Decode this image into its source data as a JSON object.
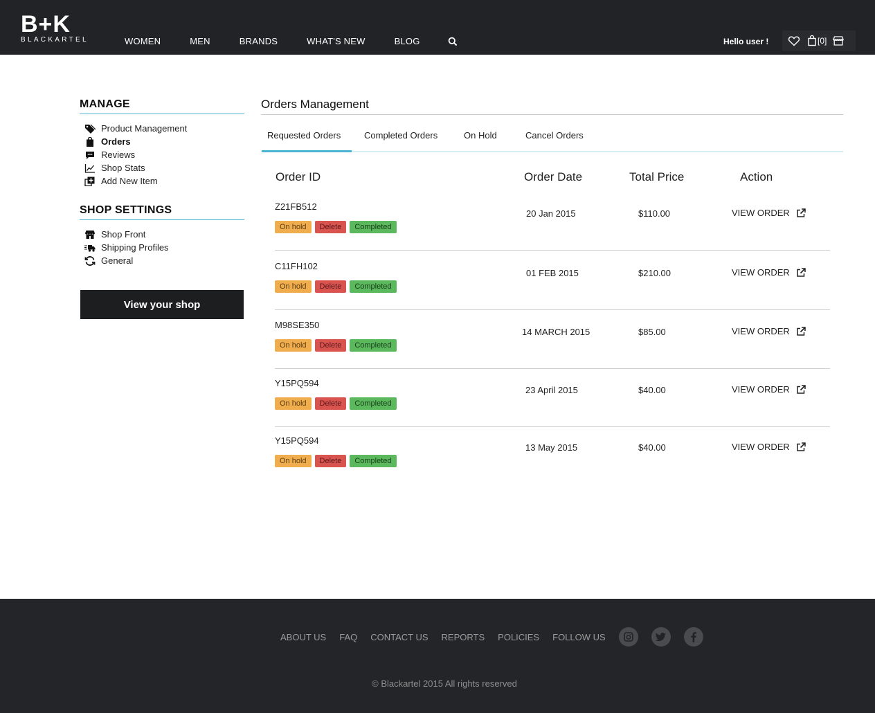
{
  "header": {
    "logo_mark": "B+K",
    "logo_word": "BLACKARTEL",
    "nav": [
      "WOMEN",
      "MEN",
      "BRANDS",
      "WHAT'S NEW",
      "BLOG"
    ],
    "greeting": "Hello user !",
    "cart_count": "[0]"
  },
  "sidebar": {
    "manage_title": "MANAGE",
    "manage_items": [
      {
        "label": "Product Management",
        "icon": "tag-icon"
      },
      {
        "label": "Orders",
        "icon": "bag-icon",
        "active": true
      },
      {
        "label": "Reviews",
        "icon": "comment-icon"
      },
      {
        "label": "Shop Stats",
        "icon": "chart-icon"
      },
      {
        "label": "Add New Item",
        "icon": "add-item-icon"
      }
    ],
    "settings_title": "SHOP SETTINGS",
    "settings_items": [
      {
        "label": "Shop Front",
        "icon": "storefront-icon"
      },
      {
        "label": "Shipping Profiles",
        "icon": "shipping-truck-icon"
      },
      {
        "label": "General",
        "icon": "refresh-icon"
      }
    ],
    "view_shop": "View your shop"
  },
  "main": {
    "title": "Orders Management",
    "tabs": [
      "Requested Orders",
      "Completed Orders",
      "On Hold",
      "Cancel Orders"
    ],
    "active_tab": "Requested Orders",
    "columns": [
      "Order ID",
      "Order Date",
      "Total Price",
      "Action"
    ],
    "badges": {
      "hold": "On hold",
      "delete": "Delete",
      "completed": "Completed"
    },
    "action_label": "VIEW ORDER",
    "orders": [
      {
        "id": "Z21FB512",
        "date": "20 Jan 2015",
        "price": "$110.00"
      },
      {
        "id": "C11FH102",
        "date": "01 FEB 2015",
        "price": "$210.00"
      },
      {
        "id": "M98SE350",
        "date": "14 MARCH 2015",
        "price": "$85.00"
      },
      {
        "id": "Y15PQ594",
        "date": "23 April 2015",
        "price": "$40.00"
      },
      {
        "id": "Y15PQ594",
        "date": "13 May 2015",
        "price": "$40.00"
      }
    ]
  },
  "footer": {
    "links": [
      "ABOUT US",
      "FAQ",
      "CONTACT US",
      "REPORTS",
      "POLICIES"
    ],
    "follow": "FOLLOW US",
    "social": [
      "instagram-icon",
      "twitter-icon",
      "facebook-icon"
    ],
    "copyright": "© Blackartel 2015 All rights reserved"
  },
  "colors": {
    "header_bg": "#222326",
    "accent": "#4cb4d0",
    "hold": "#f0ad4e",
    "delete": "#d9534f",
    "completed": "#5cb85c"
  }
}
